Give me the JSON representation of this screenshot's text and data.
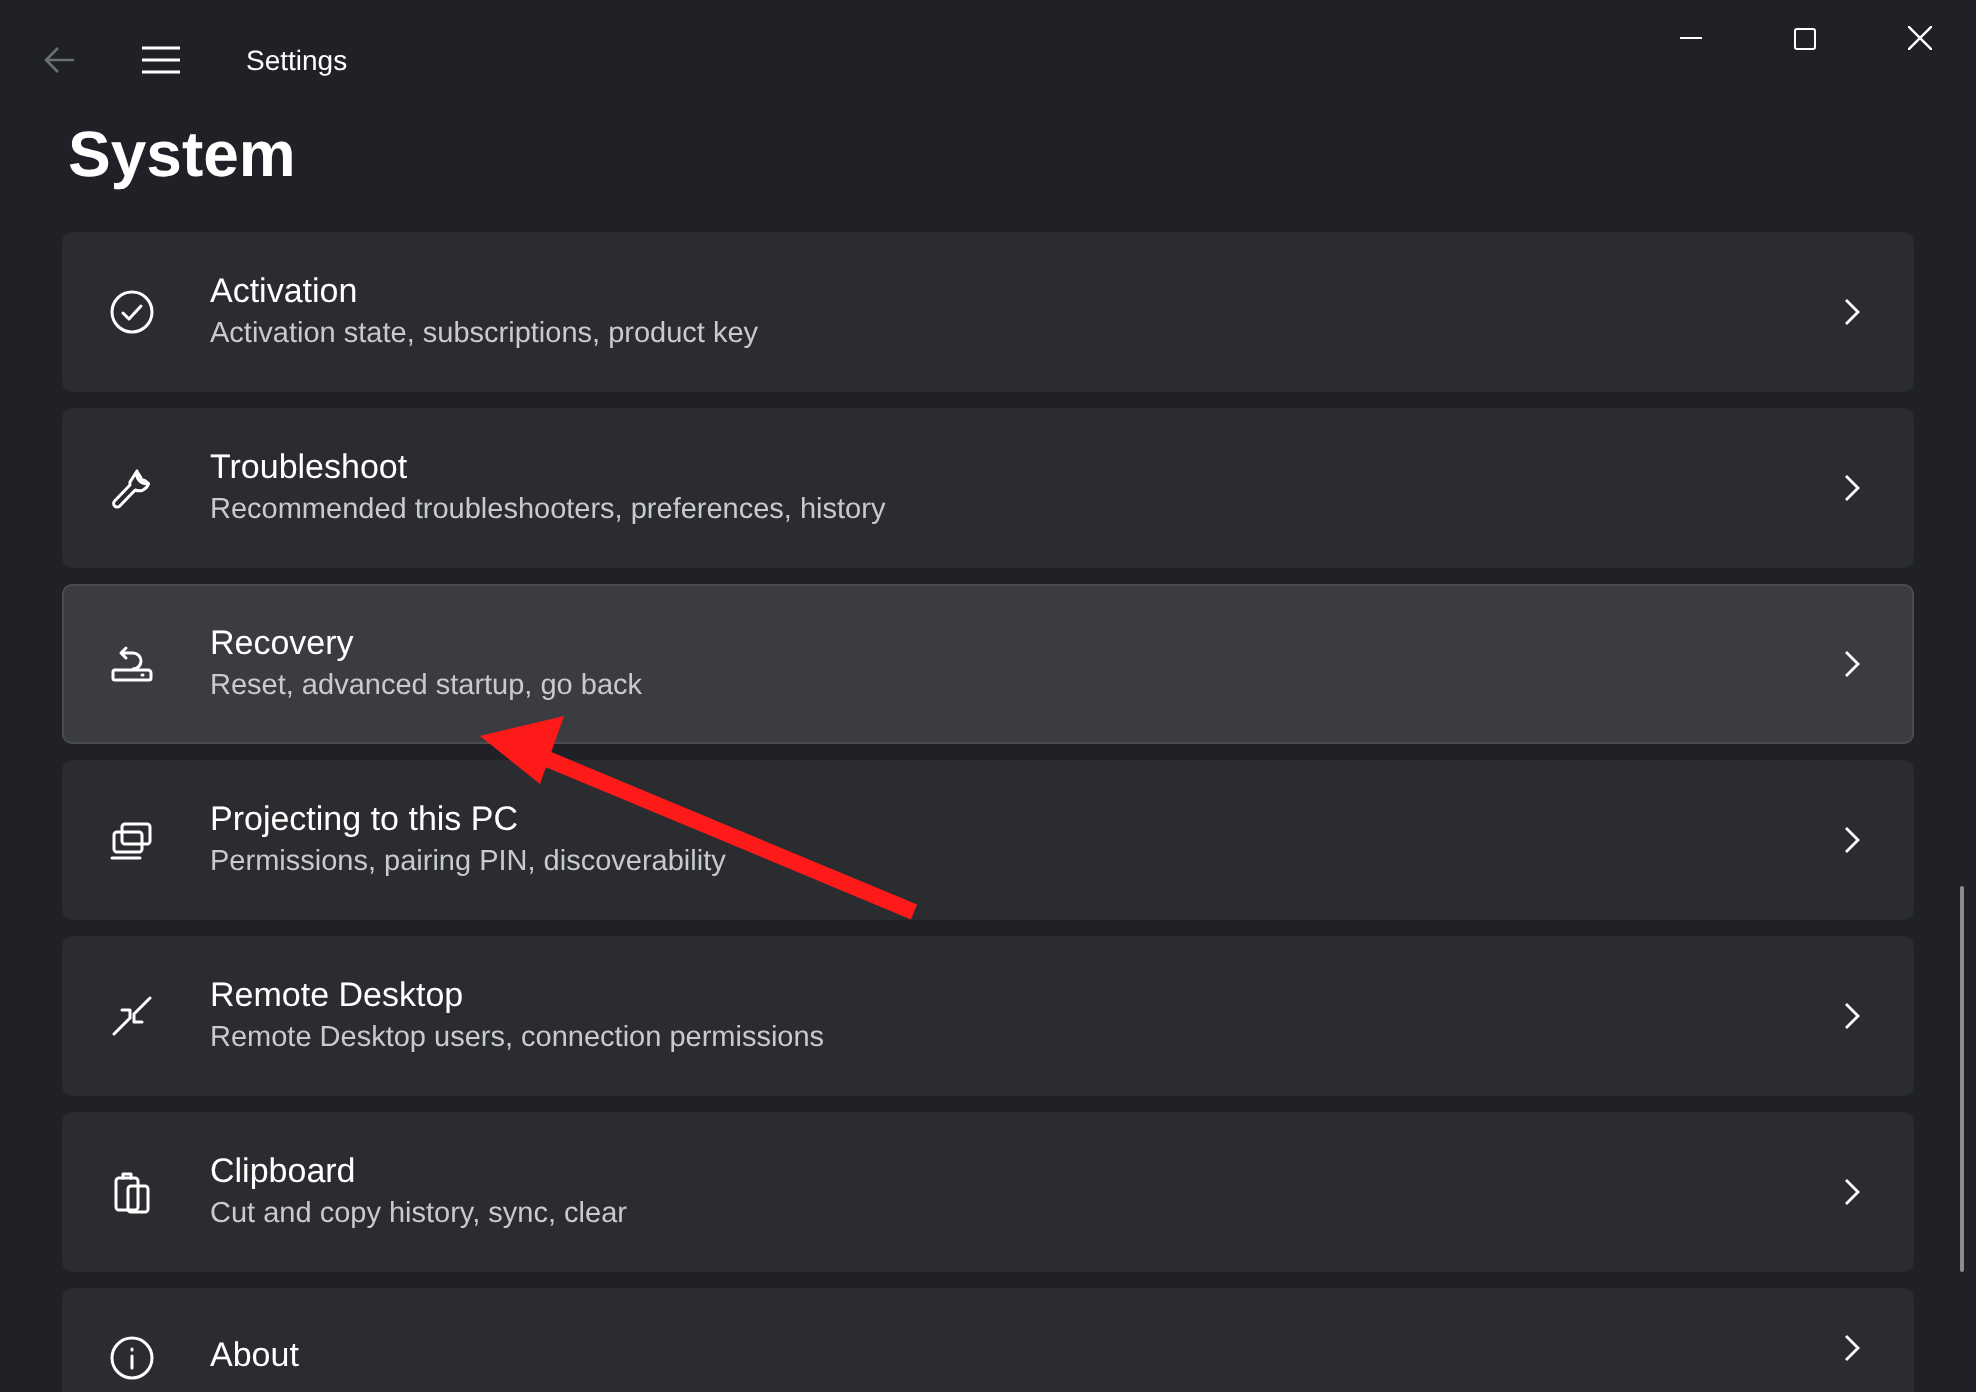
{
  "window": {
    "title": "Settings"
  },
  "page_title": "System",
  "items": [
    {
      "kind": "activation",
      "title": "Activation",
      "subtitle": "Activation state, subscriptions, product key",
      "selected": false
    },
    {
      "kind": "troubleshoot",
      "title": "Troubleshoot",
      "subtitle": "Recommended troubleshooters, preferences, history",
      "selected": false
    },
    {
      "kind": "recovery",
      "title": "Recovery",
      "subtitle": "Reset, advanced startup, go back",
      "selected": true
    },
    {
      "kind": "projecting",
      "title": "Projecting to this PC",
      "subtitle": "Permissions, pairing PIN, discoverability",
      "selected": false
    },
    {
      "kind": "remote",
      "title": "Remote Desktop",
      "subtitle": "Remote Desktop users, connection permissions",
      "selected": false
    },
    {
      "kind": "clipboard",
      "title": "Clipboard",
      "subtitle": "Cut and copy history, sync, clear",
      "selected": false
    },
    {
      "kind": "about",
      "title": "About",
      "selected": false
    }
  ]
}
